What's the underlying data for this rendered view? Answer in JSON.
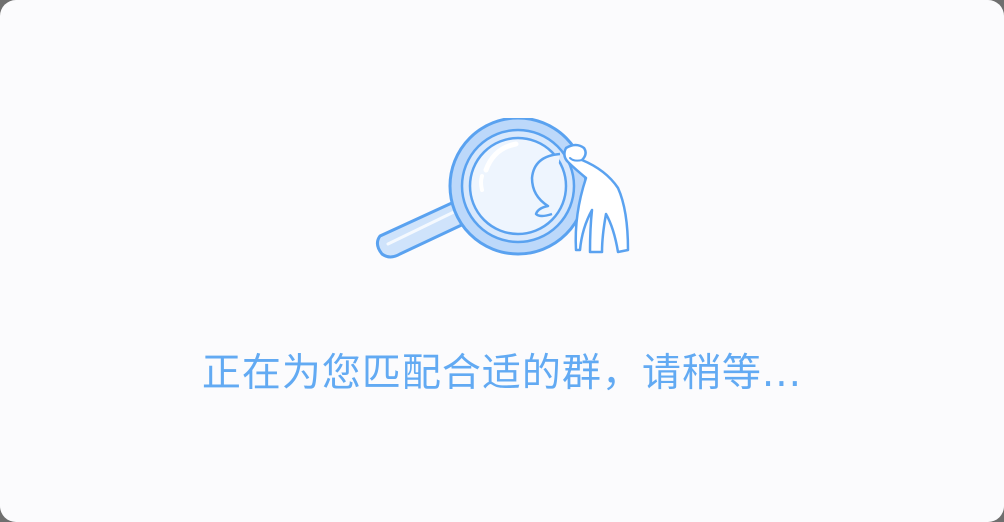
{
  "dialog": {
    "status_text": "正在为您匹配合适的群，请稍等...",
    "illustration_icon": "magnifier-searching-icon"
  },
  "colors": {
    "accent": "#62aaf3",
    "background": "#fbfbfd",
    "illustration_stroke": "#5aa2f0",
    "illustration_fill": "#cfe3fb"
  }
}
